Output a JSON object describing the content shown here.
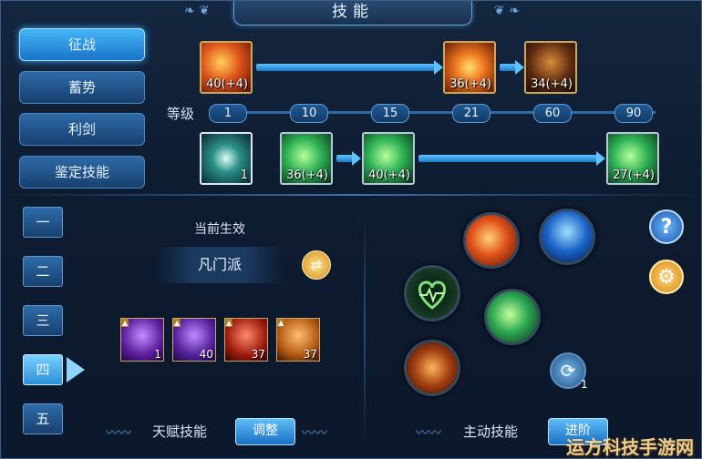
{
  "title": "技能",
  "tabs": [
    {
      "label": "征战",
      "active": true
    },
    {
      "label": "蓄势",
      "active": false
    },
    {
      "label": "利剑",
      "active": false
    },
    {
      "label": "鉴定技能",
      "active": false
    }
  ],
  "tree": {
    "level_label": "等级",
    "levels": [
      "1",
      "10",
      "15",
      "21",
      "60",
      "90"
    ],
    "top_row": [
      {
        "icon": "fire-slash-skill-icon",
        "value": "40(+4)"
      },
      {
        "icon": "flame-burst-skill-icon",
        "value": "36(+4)"
      },
      {
        "icon": "archer-skill-icon",
        "value": "34(+4)"
      }
    ],
    "bottom_row": [
      {
        "icon": "fist-skill-icon",
        "value": "1"
      },
      {
        "icon": "green-strike-skill-icon",
        "value": "36(+4)"
      },
      {
        "icon": "green-power-skill-icon",
        "value": "40(+4)"
      },
      {
        "icon": "green-rage-skill-icon",
        "value": "27(+4)"
      }
    ]
  },
  "talent": {
    "pages": [
      "一",
      "二",
      "三",
      "四",
      "五"
    ],
    "selected_page": "四",
    "current_label": "当前生效",
    "faction": "凡门派",
    "skills": [
      {
        "icon": "purple-bow-talent-icon",
        "value": "1"
      },
      {
        "icon": "purple-dash-talent-icon",
        "value": "40"
      },
      {
        "icon": "red-warrior-talent-icon",
        "value": "37"
      },
      {
        "icon": "orange-archer-talent-icon",
        "value": "37"
      }
    ],
    "footer_label": "天赋技能",
    "adjust_button": "调整"
  },
  "active": {
    "footer_label": "主动技能",
    "advance_button": "进阶",
    "swap_count": "1",
    "orbs": [
      "fire-slash-orb-icon",
      "muscle-orb-icon",
      "heart-pulse-orb-icon",
      "green-power-orb-icon",
      "lava-hand-orb-icon"
    ]
  },
  "side_buttons": {
    "help": "?",
    "settings": "gear-icon"
  },
  "watermark": "运方科技手游网"
}
